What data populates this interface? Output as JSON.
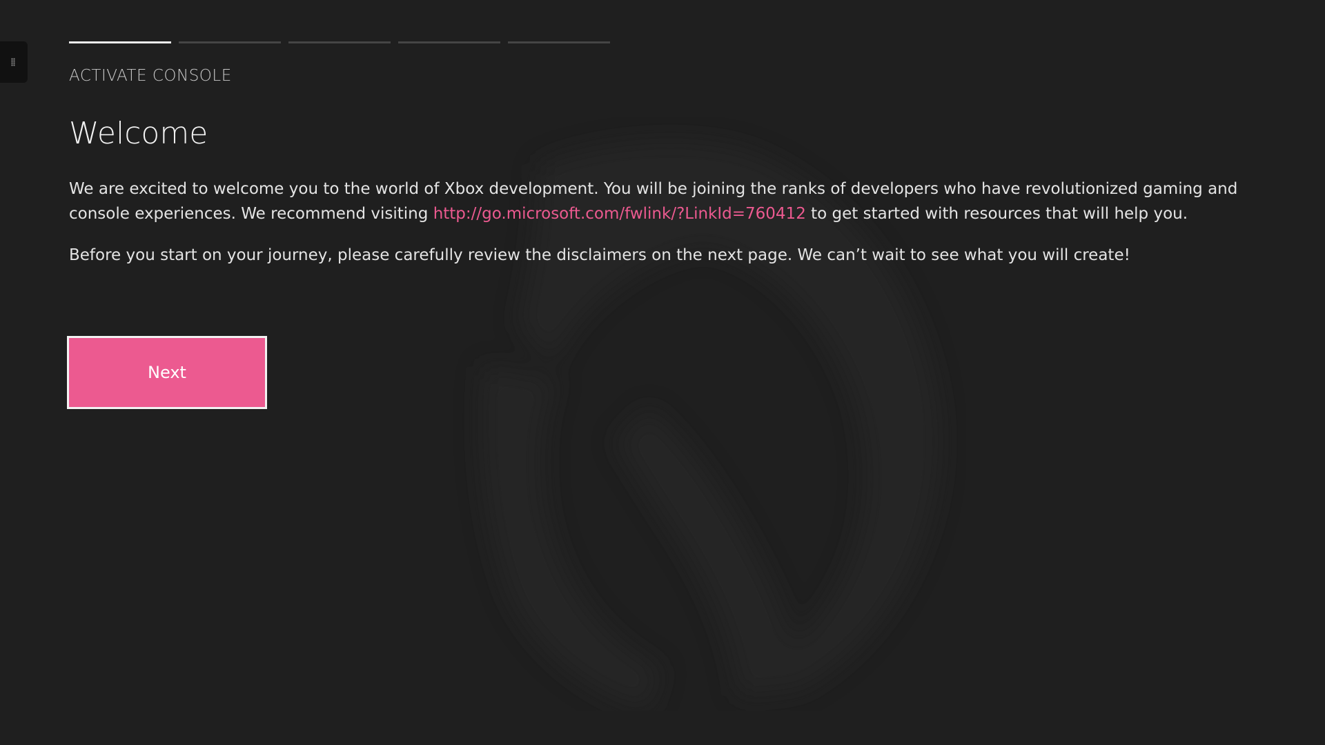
{
  "header": {
    "section_label": "ACTIVATE CONSOLE",
    "progress": {
      "total_steps": 5,
      "current_step": 1
    }
  },
  "main": {
    "title": "Welcome",
    "paragraph1": {
      "before_link": "We are excited to welcome you to the world of Xbox development. You will be joining the ranks of developers who have revolutionized gaming and console experiences. We recommend visiting ",
      "link": "http://go.microsoft.com/fwlink/?LinkId=760412",
      "after_link": " to get started with resources that will help you."
    },
    "paragraph2": "Before you start on your journey, please carefully review the disclaimers on the next page. We can’t wait to see what you will create!"
  },
  "actions": {
    "next_label": "Next"
  },
  "colors": {
    "accent": "#ec5a90",
    "background": "#1f1f1f",
    "text": "#e4e4e4"
  },
  "icons": {
    "background_logo": "xbox-logo-icon",
    "side_handle": "drag-handle-icon"
  }
}
